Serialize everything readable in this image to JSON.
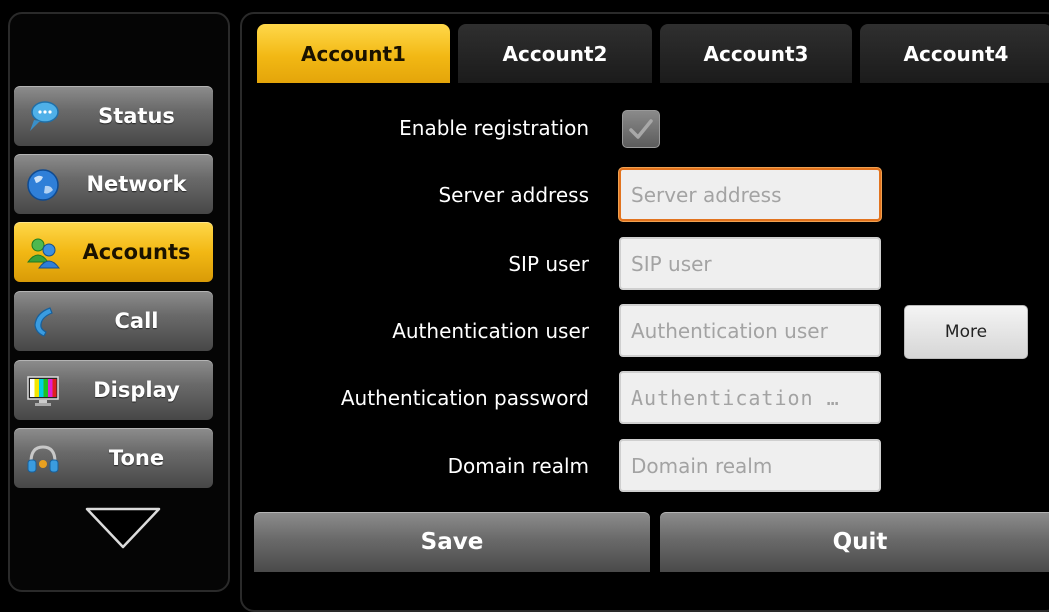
{
  "sidebar": {
    "items": [
      {
        "label": "Status",
        "icon": "status-chat-bubble-icon"
      },
      {
        "label": "Network",
        "icon": "network-globe-icon"
      },
      {
        "label": "Accounts",
        "icon": "accounts-users-icon",
        "active": true
      },
      {
        "label": "Call",
        "icon": "call-handset-icon"
      },
      {
        "label": "Display",
        "icon": "display-monitor-icon"
      },
      {
        "label": "Tone",
        "icon": "tone-headset-icon"
      }
    ],
    "scroll_icon": "chevron-down-triangle-icon"
  },
  "tabs": [
    {
      "label": "Account1",
      "active": true
    },
    {
      "label": "Account2"
    },
    {
      "label": "Account3"
    },
    {
      "label": "Account4"
    }
  ],
  "form": {
    "enable_registration": {
      "label": "Enable registration",
      "checked": true
    },
    "server_address": {
      "label": "Server address",
      "placeholder": "Server address"
    },
    "sip_user": {
      "label": "SIP user",
      "placeholder": "SIP user"
    },
    "auth_user": {
      "label": "Authentication user",
      "placeholder": "Authentication user"
    },
    "auth_password": {
      "label": "Authentication password",
      "placeholder": "Authentication …"
    },
    "domain_realm": {
      "label": "Domain realm",
      "placeholder": "Domain realm"
    },
    "more_label": "More"
  },
  "actions": {
    "save_label": "Save",
    "quit_label": "Quit"
  },
  "colors": {
    "accent": "#f2b814",
    "focus": "#e2731e"
  }
}
